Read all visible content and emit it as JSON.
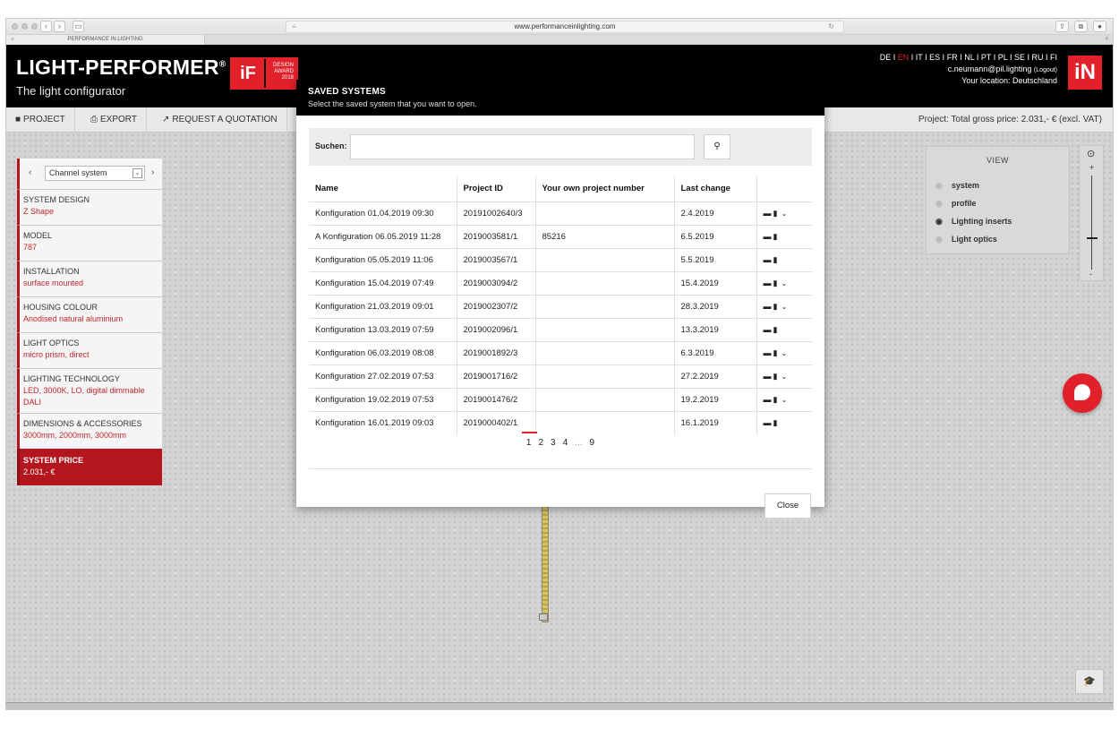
{
  "browser": {
    "url": "www.performanceinlighting.com",
    "tab_title": "PERFORMANCE IN LIGHTING"
  },
  "header": {
    "brand": "LIGHT-PERFORMER",
    "brand_mark": "®",
    "subtitle": "The light configurator",
    "award_logo": "iF",
    "award_line1": "DESIGN",
    "award_line2": "AWARD",
    "award_line3": "2018",
    "languages": [
      "DE",
      "EN",
      "IT",
      "ES",
      "FR",
      "NL",
      "PT",
      "PL",
      "SE",
      "RU",
      "FI"
    ],
    "active_language": "EN",
    "user_email": "c.neumann@pil.lighting",
    "logout_label": "(Logout)",
    "location": "Your location: Deutschland",
    "logo": "iN"
  },
  "toolbar": {
    "project_label": "PROJECT",
    "export_label": "EXPORT",
    "quotation_label": "REQUEST A QUOTATION",
    "price_summary": "Project: Total gross price: 2.031,- € (excl. VAT)"
  },
  "sidebar": {
    "system_select": "Channel system",
    "items": [
      {
        "title": "SYSTEM DESIGN",
        "value": "Z Shape"
      },
      {
        "title": "MODEL",
        "value": "787"
      },
      {
        "title": "INSTALLATION",
        "value": "surface mounted"
      },
      {
        "title": "HOUSING COLOUR",
        "value": "Anodised natural aluminium"
      },
      {
        "title": "LIGHT OPTICS",
        "value": "micro prism, direct"
      },
      {
        "title": "LIGHTING TECHNOLOGY",
        "value": "LED, 3000K, LO, digital dimmable DALI"
      },
      {
        "title": "DIMENSIONS & ACCESSORIES",
        "value": "3000mm, 2000mm, 3000mm"
      }
    ],
    "price": {
      "title": "SYSTEM PRICE",
      "value": "2.031,- €"
    }
  },
  "view_panel": {
    "title": "VIEW",
    "options": [
      {
        "label": "system",
        "visible": false
      },
      {
        "label": "profile",
        "visible": false
      },
      {
        "label": "Lighting inserts",
        "visible": true
      },
      {
        "label": "Light optics",
        "visible": false
      }
    ],
    "zoom_plus": "+",
    "zoom_minus": "-"
  },
  "modal": {
    "title": "SAVED SYSTEMS",
    "subtitle": "Select the saved system that you want to open.",
    "search_label": "Suchen:",
    "search_value": "",
    "columns": [
      "Name",
      "Project ID",
      "Your own project number",
      "Last change",
      ""
    ],
    "rows": [
      {
        "name": "Konfiguration 01.04.2019 09:30",
        "id": "20191002640/3",
        "own": "",
        "changed": "2.4.2019",
        "expand": true
      },
      {
        "name": "A Konfiguration 06.05.2019 11:28",
        "id": "2019003581/1",
        "own": "85216",
        "changed": "6.5.2019",
        "expand": false
      },
      {
        "name": "Konfiguration 05.05.2019 11:06",
        "id": "2019003567/1",
        "own": "",
        "changed": "5.5.2019",
        "expand": false
      },
      {
        "name": "Konfiguration 15.04.2019 07:49",
        "id": "2019003094/2",
        "own": "",
        "changed": "15.4.2019",
        "expand": true
      },
      {
        "name": "Konfiguration 21.03.2019 09:01",
        "id": "2019002307/2",
        "own": "",
        "changed": "28.3.2019",
        "expand": true
      },
      {
        "name": "Konfiguration 13.03.2019 07:59",
        "id": "2019002096/1",
        "own": "",
        "changed": "13.3.2019",
        "expand": false
      },
      {
        "name": "Konfiguration 06.03.2019 08:08",
        "id": "2019001892/3",
        "own": "",
        "changed": "6.3.2019",
        "expand": true
      },
      {
        "name": "Konfiguration 27.02.2019 07:53",
        "id": "2019001716/2",
        "own": "",
        "changed": "27.2.2019",
        "expand": true
      },
      {
        "name": "Konfiguration 19.02.2019 07:53",
        "id": "2019001476/2",
        "own": "",
        "changed": "19.2.2019",
        "expand": true
      },
      {
        "name": "Konfiguration 16.01.2019 09:03",
        "id": "2019000402/1",
        "own": "",
        "changed": "16.1.2019",
        "expand": false
      }
    ],
    "pages": [
      "1",
      "2",
      "3",
      "4",
      "...",
      "9"
    ],
    "active_page": "1",
    "close_label": "Close"
  },
  "icons": {
    "open": "folder-icon",
    "delete": "trash-icon",
    "expand": "chevron-down-icon",
    "search": "search-icon"
  },
  "colors": {
    "accent_red": "#e2202a",
    "sidebar_red": "#b3161d",
    "header_black": "#000000"
  }
}
